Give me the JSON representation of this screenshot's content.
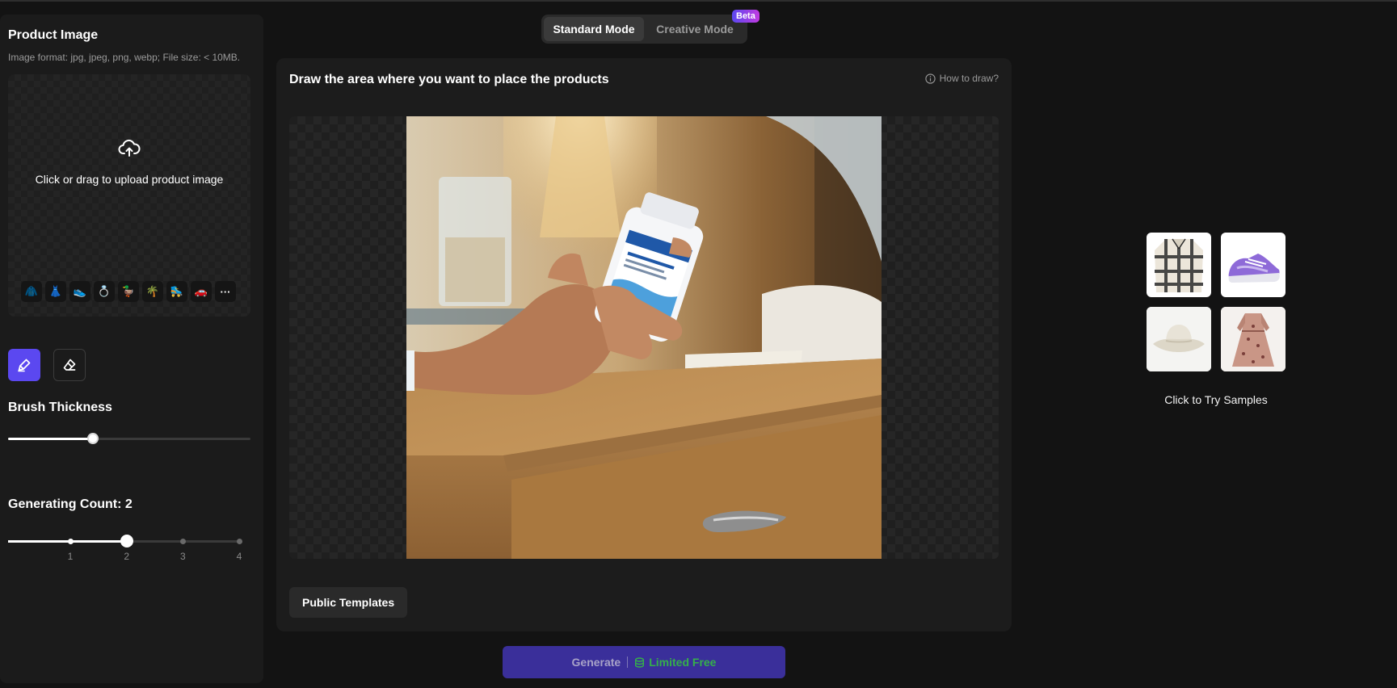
{
  "left": {
    "title": "Product Image",
    "format_hint": "Image format: jpg, jpeg, png, webp; File size:  < 10MB.",
    "upload_text": "Click or drag to upload product image",
    "categories": [
      {
        "icon": "jacket-icon",
        "glyph": "🧥"
      },
      {
        "icon": "dress-icon",
        "glyph": "👗"
      },
      {
        "icon": "shoe-icon",
        "glyph": "👟"
      },
      {
        "icon": "ring-icon",
        "glyph": "💍"
      },
      {
        "icon": "duck-icon",
        "glyph": "🦆"
      },
      {
        "icon": "palm-tree-icon",
        "glyph": "🌴"
      },
      {
        "icon": "roller-skate-icon",
        "glyph": "🛼"
      },
      {
        "icon": "car-icon",
        "glyph": "🚗"
      },
      {
        "icon": "more-icon",
        "glyph": "···"
      }
    ],
    "brush_label": "Brush Thickness",
    "brush_value": 0.35,
    "count_label": "Generating Count: 2",
    "count_value": 2,
    "count_ticks": [
      "1",
      "2",
      "3",
      "4"
    ]
  },
  "modes": {
    "standard": "Standard Mode",
    "creative": "Creative Mode",
    "badge": "Beta"
  },
  "main": {
    "title": "Draw the area where you want to place the products",
    "howto": "How to draw?",
    "templates": "Public Templates"
  },
  "generate": {
    "label": "Generate",
    "free": "Limited Free"
  },
  "samples": {
    "label": "Click to Try Samples",
    "items": [
      "plaid-shirt-sample",
      "purple-sneaker-sample",
      "bucket-hat-sample",
      "floral-dress-sample"
    ]
  },
  "colors": {
    "accent": "#5b48f0",
    "generate_bg": "#3a2f9a",
    "free_green": "#35b04a"
  }
}
